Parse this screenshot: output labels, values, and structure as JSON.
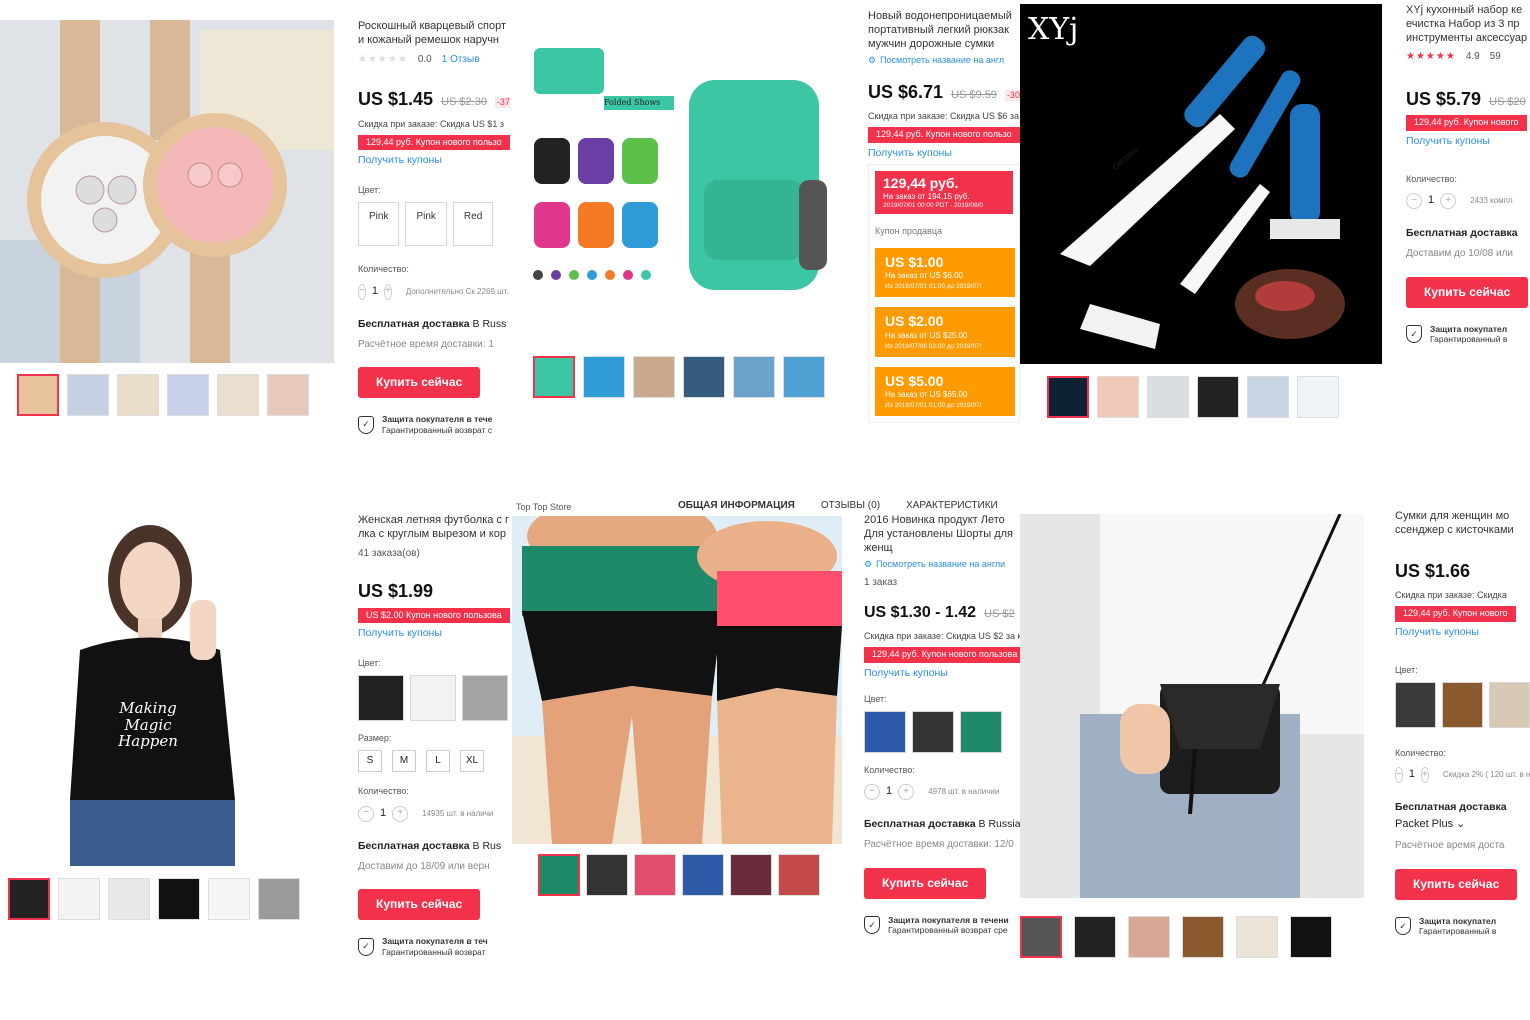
{
  "tiles": {
    "watch": {
      "title": "Роскошный кварцевый спорт и кожаный ремешок наручн",
      "rating": "0.0",
      "reviews": "1 Отзыв",
      "price": "US $1.45",
      "old_price": "US $2.30",
      "discount": "-37%",
      "order_discount": "Скидка при заказе: Скидка US $1 з",
      "coupon": "129,44 руб. Купон нового пользо",
      "get_coupons": "Получить купоны",
      "color_label": "Цвет:",
      "colors": [
        "Pink",
        "Pink",
        "Red"
      ],
      "qty_label": "Количество:",
      "qty": "1",
      "stock": "Дополнительно Ск 2269 шт. в наличи",
      "shipping": "Бесплатная доставка",
      "shipping_to": "В Russ",
      "eta": "Расчётное время доставки: 1",
      "buy": "Купить сейчас",
      "protection_title": "Защита покупателя в тече",
      "protection_sub": "Гарантированный возврат с"
    },
    "backpack": {
      "title": "Новый водонепроницаемый портативный легкий рюкзак мужчин дорожные сумки",
      "translate": "Посмотреть название на англ",
      "price": "US $6.71",
      "old_price": "US $9.59",
      "discount": "-30%",
      "order_discount": "Скидка при заказе: Скидка US $6 за",
      "coupon": "129,44 руб. Купон нового пользо",
      "get_coupons": "Получить купоны",
      "popup_amount": "129,44 руб.",
      "popup_min": "На заказ от 194,15 руб.",
      "popup_dates": "2019/07/01 00:00 PDT - 2019/08/0",
      "seller_coupons": "Купон продавца",
      "seller_list": [
        {
          "amount": "US $1.00",
          "min": "На заказ от US $6.00",
          "dates": "Из 2019/07/01 01:00 до 2019/07/"
        },
        {
          "amount": "US $2.00",
          "min": "На заказ от US $25.00",
          "dates": "Из 2019/07/06 02:00 до 2019/07/"
        },
        {
          "amount": "US $5.00",
          "min": "На заказ от US $65.00",
          "dates": "Из 2019/07/01 01:00 до 2019/07/"
        }
      ],
      "folded_label": "Folded Shows"
    },
    "knives": {
      "title": "XYj кухонный набор ке ечистка Набор из 3 пр инструменты аксессуар",
      "rating": "4.9",
      "reviews": "59",
      "price": "US $5.79",
      "old_price": "US $20",
      "coupon": "129,44 руб. Купон нового",
      "get_coupons": "Получить купоны",
      "qty_label": "Количество:",
      "qty": "1",
      "stock": "2433 компл",
      "shipping": "Бесплатная доставка",
      "eta": "Доставим до 10/08 или",
      "buy": "Купить сейчас",
      "protection_title": "Защита покупател",
      "protection_sub": "Гарантированный в",
      "logo": "XYj",
      "brand_text": "Ceramic"
    },
    "tshirt": {
      "title": "Женская летняя футболка с г лка с круглым вырезом и кор",
      "orders": "41 заказа(ов)",
      "price": "US $1.99",
      "coupon": "US $2.00 Купон нового пользова",
      "get_coupons": "Получить купоны",
      "color_label": "Цвет:",
      "size_label": "Размер:",
      "sizes": [
        "S",
        "M",
        "L",
        "XL"
      ],
      "qty_label": "Количество:",
      "qty": "1",
      "stock": "14935 шт. в наличи",
      "shipping": "Бесплатная доставка",
      "shipping_to": "В Rus",
      "eta": "Доставим до 18/09 или верн",
      "buy": "Купить сейчас",
      "protection_title": "Защита покупателя в теч",
      "protection_sub": "Гарантированный возврат",
      "shirt_text": "Making Magic Happen"
    },
    "shorts": {
      "store": "Top Top Store",
      "tabs": [
        "ОБЩАЯ ИНФОРМАЦИЯ",
        "ОТЗЫВЫ (0)",
        "ХАРАКТЕРИСТИКИ"
      ],
      "title": "2016 Новинка продукт Лето Для установлены Шорты для женщ",
      "translate": "Посмотреть название на англи",
      "orders": "1 заказ",
      "price": "US $1.30 - 1.42",
      "old_price": "US $2",
      "order_discount": "Скидка при заказе: Скидка US $2 за к",
      "coupon": "129,44 руб. Купон нового пользова",
      "get_coupons": "Получить купоны",
      "color_label": "Цвет:",
      "qty_label": "Количество:",
      "qty": "1",
      "stock": "4978 шт. в наличии",
      "shipping": "Бесплатная доставка",
      "shipping_to": "В Russia",
      "eta": "Расчётное время доставки: 12/0",
      "buy": "Купить сейчас",
      "protection_title": "Защита покупателя в течени",
      "protection_sub": "Гарантированный возврат сре"
    },
    "bag": {
      "title": "Сумки для женщин мо ссенджер с кисточками",
      "price": "US $1.66",
      "order_discount": "Скидка при заказе: Скидка",
      "coupon": "129,44 руб. Купон нового",
      "get_coupons": "Получить купоны",
      "color_label": "Цвет:",
      "qty_label": "Количество:",
      "qty": "1",
      "stock": "Скидка 2% ( 120 шт. в на",
      "shipping": "Бесплатная доставка",
      "shipping_method": "Packet Plus ⌄",
      "eta": "Расчётное время доста",
      "buy": "Купить сейчас",
      "protection_title": "Защита покупател",
      "protection_sub": "Гарантированный в"
    }
  },
  "colors": {
    "accent_red": "#f2314b",
    "link_blue": "#2a8ee6",
    "coupon_orange": "#ff9a00",
    "backpack_teal": "#3cc6a3",
    "knife_blue": "#1e73be"
  }
}
